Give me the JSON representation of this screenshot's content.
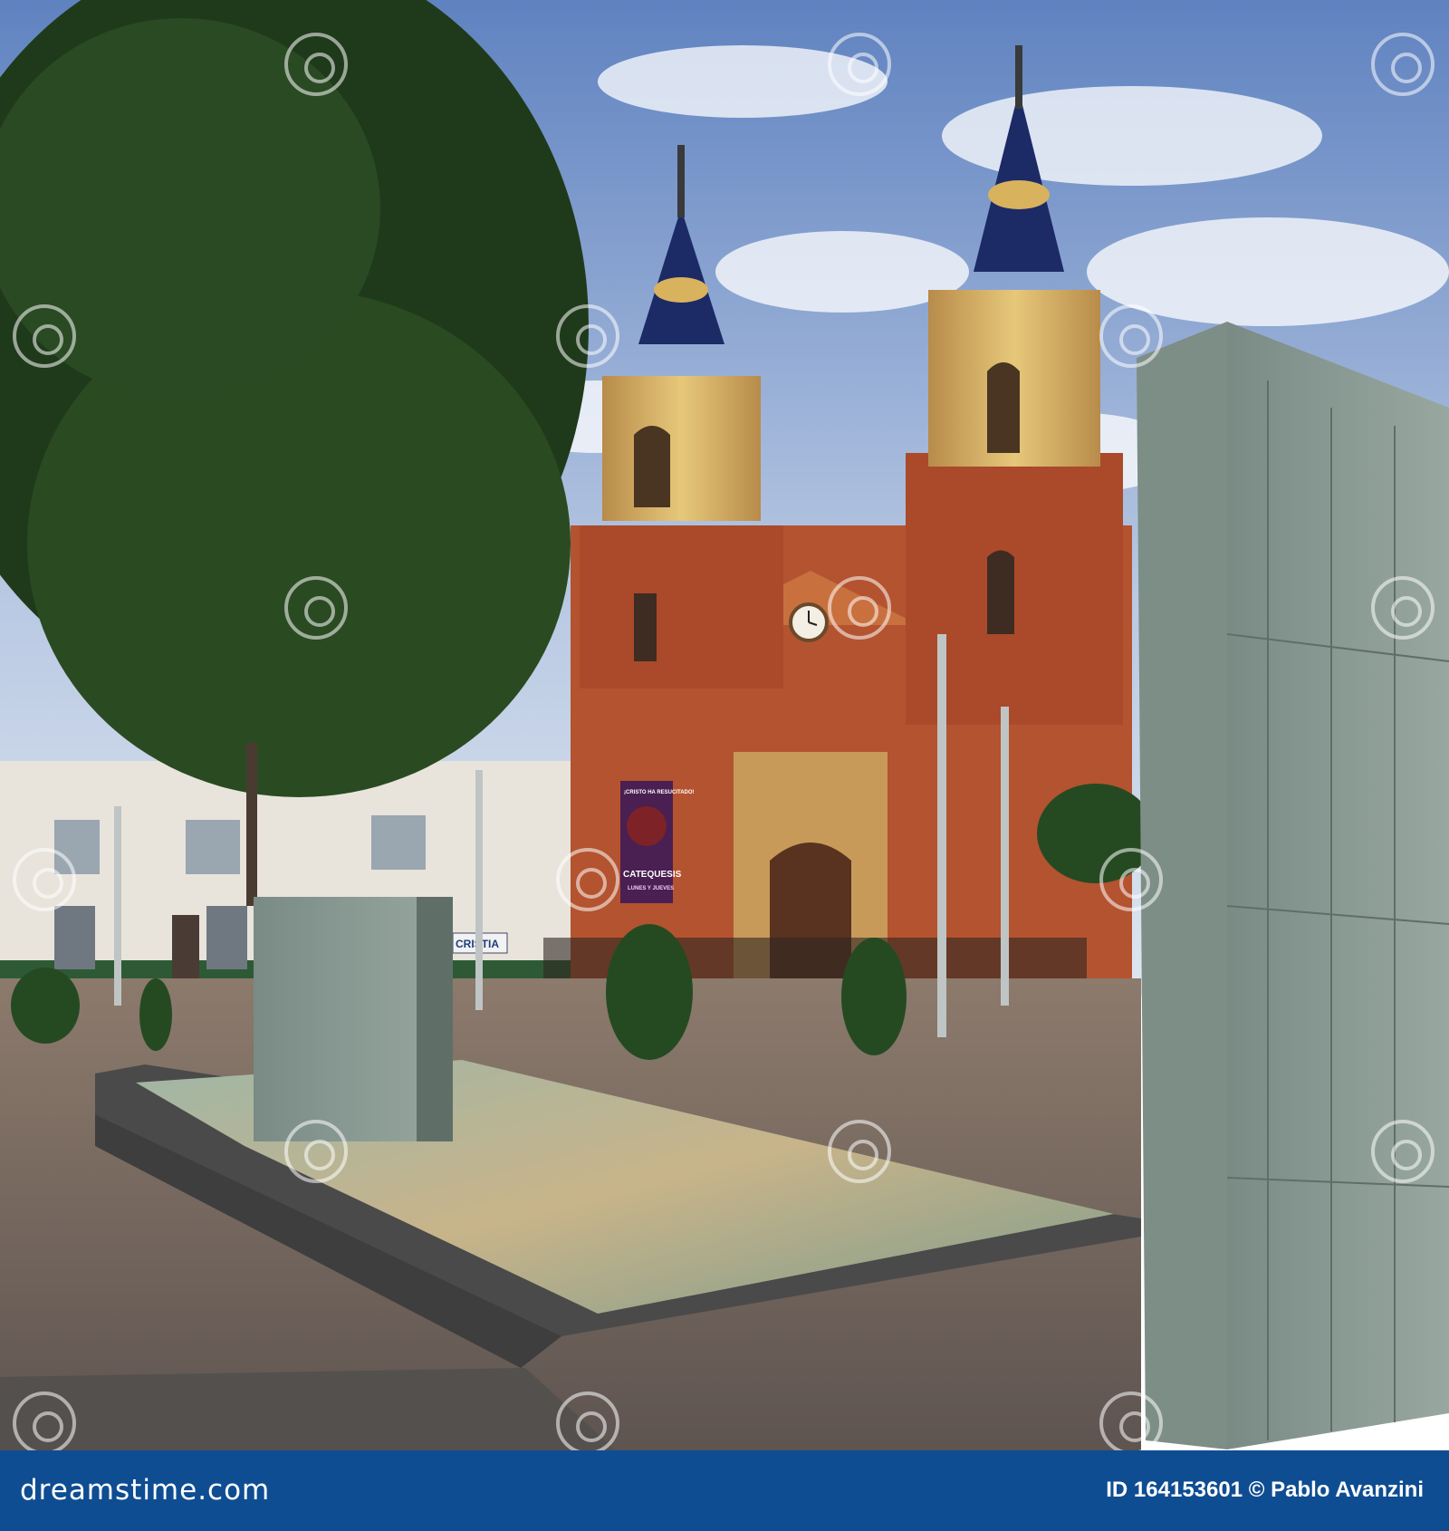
{
  "photo": {
    "subject": "church-plaza",
    "banner": {
      "line1": "¡CRISTO HA RESUCITADO!",
      "line2": "CATEQUESIS",
      "line3": "LUNES Y JUEVES"
    },
    "shop_sign": "CRISTIA"
  },
  "watermark": {
    "text": "dreamstime"
  },
  "footer": {
    "brand": "dreamstime.com",
    "credit": "ID 164153601 © Pablo Avanzini"
  },
  "colors": {
    "sky": "#6f8fc6",
    "brick": "#b4532f",
    "stone": "#d8b86a",
    "dome": "#1c2a66",
    "tree": "#1f3a1a",
    "slate": "#7f918a",
    "footer": "#0f4d92"
  }
}
